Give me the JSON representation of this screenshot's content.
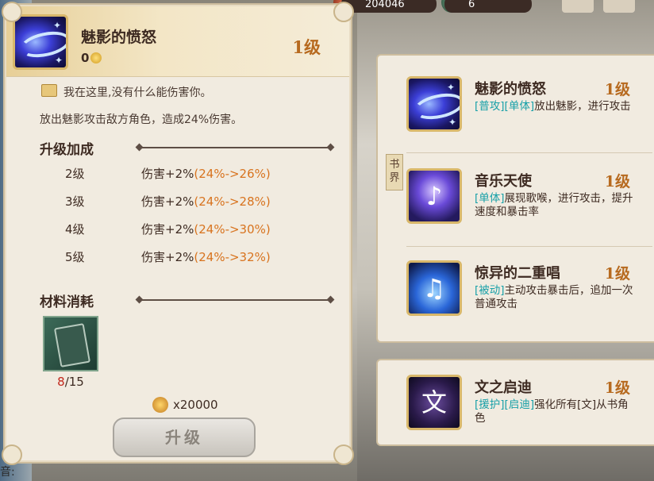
{
  "hud": {
    "gold": "204046",
    "gems": "6"
  },
  "detail": {
    "skill_name": "魅影的愤怒",
    "coin_value": "0",
    "level": "1级",
    "quote": "我在这里,没有什么能伤害你。",
    "description": "放出魅影攻击敌方角色，造成24%伤害。",
    "upgrade_title": "升级加成",
    "upgrades": [
      {
        "level": "2级",
        "effect": "伤害+2%",
        "range": "(24%->26%)"
      },
      {
        "level": "3级",
        "effect": "伤害+2%",
        "range": "(24%->28%)"
      },
      {
        "level": "4级",
        "effect": "伤害+2%",
        "range": "(24%->30%)"
      },
      {
        "level": "5级",
        "effect": "伤害+2%",
        "range": "(24%->32%)"
      }
    ],
    "material_title": "材料消耗",
    "material_have": "8",
    "material_need": "/15",
    "cost": "x20000",
    "upgrade_button": "升级"
  },
  "book_tab": "书界",
  "skills": [
    {
      "name": "魅影的愤怒",
      "level": "1级",
      "tags": [
        "[普攻]",
        "[单体]"
      ],
      "desc": "放出魅影，进行攻击",
      "icon": "phantom-swirl-icon"
    },
    {
      "name": "音乐天使",
      "level": "1级",
      "tags": [
        "[单体]"
      ],
      "desc": "展现歌喉，进行攻击，提升速度和暴击率",
      "icon": "music-angel-icon"
    },
    {
      "name": "惊异的二重唱",
      "level": "1级",
      "tags": [
        "[被动]"
      ],
      "desc": "主动攻击暴击后，追加一次普通攻击",
      "icon": "music-note-icon"
    }
  ],
  "assist_skill": {
    "name": "文之启迪",
    "level": "1级",
    "tags": [
      "[援护]",
      "[启迪]"
    ],
    "desc": "强化所有[文]从书角色",
    "glyph": "文",
    "icon": "wen-glyph-icon"
  },
  "bottom_text": "音:"
}
